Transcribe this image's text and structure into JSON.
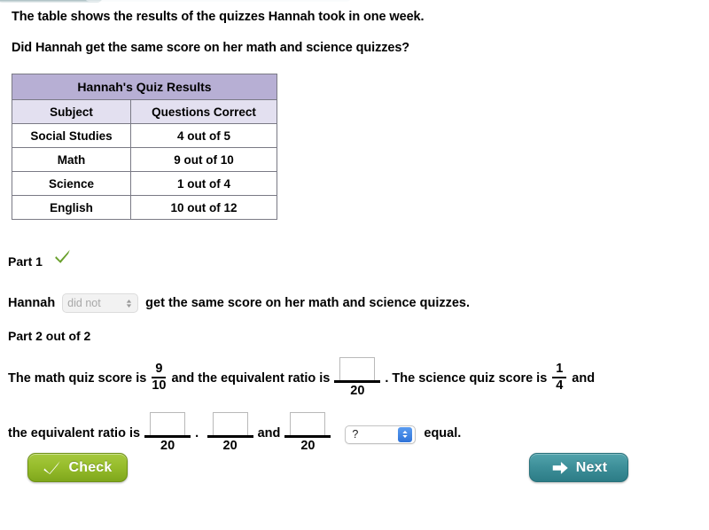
{
  "prompt": {
    "line1": "The table shows the results of the quizzes Hannah took in one week.",
    "line2": "Did Hannah get the same score on her math and science quizzes?"
  },
  "table": {
    "title": "Hannah's Quiz Results",
    "headers": [
      "Subject",
      "Questions Correct"
    ],
    "rows": [
      [
        "Social Studies",
        "4 out of 5"
      ],
      [
        "Math",
        "9 out of 10"
      ],
      [
        "Science",
        "1 out of 4"
      ],
      [
        "English",
        "10 out of 12"
      ]
    ]
  },
  "part1": {
    "label": "Part 1",
    "status_icon": "green-check-icon",
    "sentence_before": "Hannah",
    "select_value": "did not",
    "sentence_after": "get the same score on her math and science quizzes."
  },
  "part2": {
    "label": "Part 2 out of 2",
    "row1": {
      "text1": "The math quiz score is",
      "math_fraction": {
        "numerator": "9",
        "denominator": "10"
      },
      "text2": "and the equivalent ratio is",
      "blank1": {
        "value": "",
        "denominator": "20"
      },
      "text3": ". The science quiz score is",
      "science_fraction": {
        "numerator": "1",
        "denominator": "4"
      },
      "text4": "and"
    },
    "row2": {
      "text1": "the equivalent ratio is",
      "blank2": {
        "value": "",
        "denominator": "20"
      },
      "text2": ".",
      "blank3": {
        "value": "",
        "denominator": "20"
      },
      "text3": "and",
      "blank4": {
        "value": "",
        "denominator": "20"
      },
      "select_value": "?",
      "text4": "equal."
    }
  },
  "buttons": {
    "check": {
      "label": "Check",
      "icon": "checkmark-icon",
      "color": "#96bc2b"
    },
    "next": {
      "label": "Next",
      "icon": "right-arrow-icon",
      "color": "#3d8f99"
    }
  },
  "colors": {
    "table_title_bg": "#b7afd4",
    "table_header_bg": "#e3e0f0",
    "check_green": "#69a02c",
    "stepper_blue": "#2f73d8"
  }
}
